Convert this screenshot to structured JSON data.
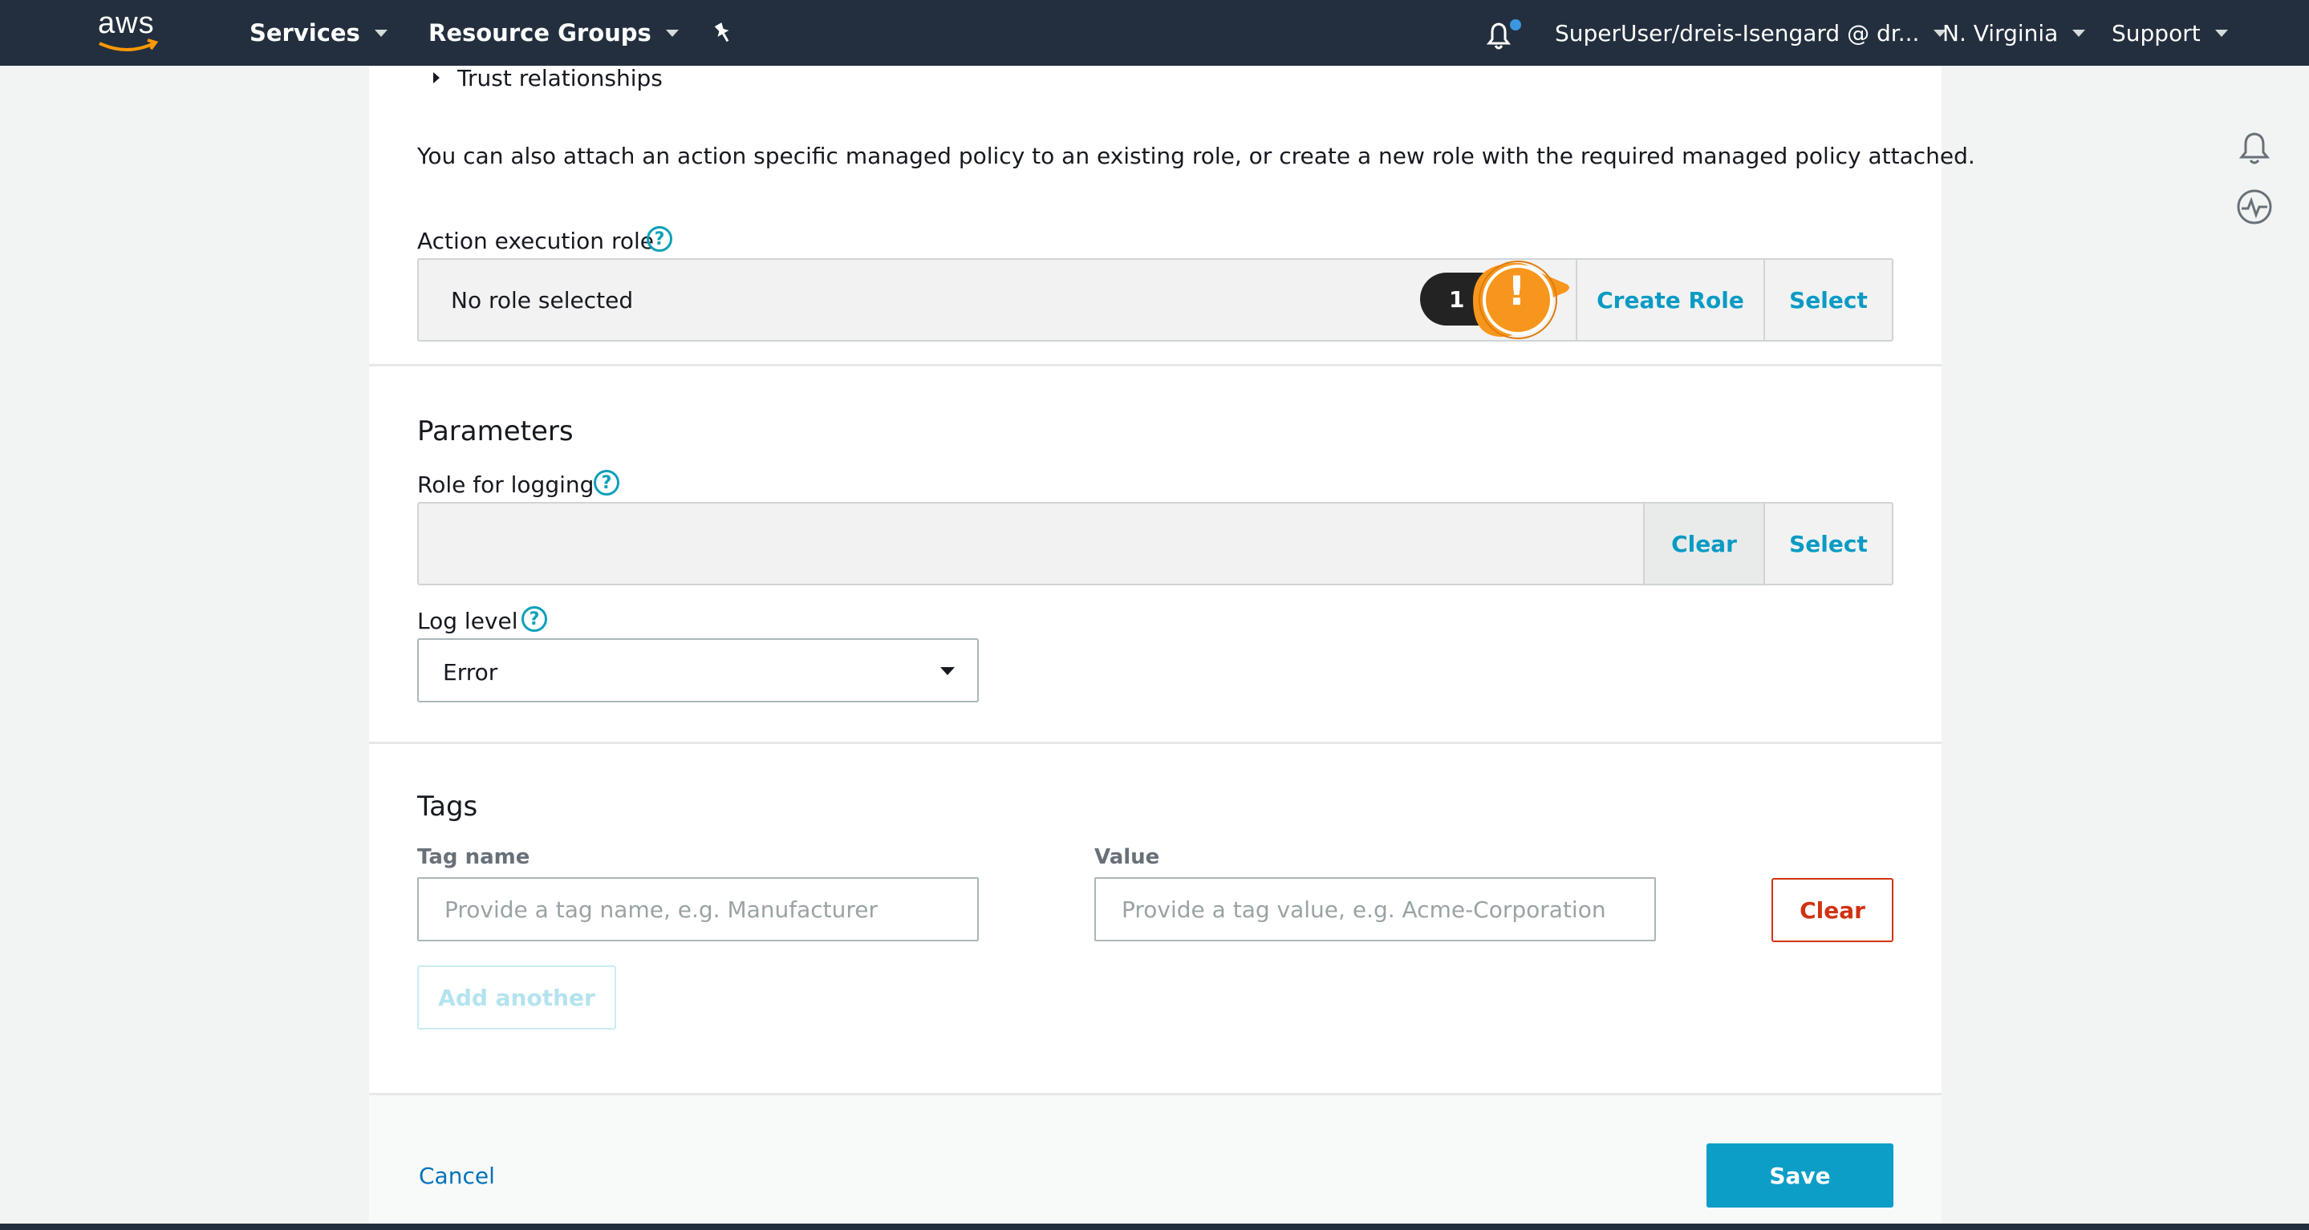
{
  "nav": {
    "logo": "aws",
    "services": "Services",
    "resource_groups": "Resource Groups",
    "account": "SuperUser/dreis-Isengard @ dr...",
    "region": "N. Virginia",
    "support": "Support"
  },
  "trust": {
    "label": "Trust relationships"
  },
  "info_text": "You can also attach an action specific managed policy to an existing role, or create a new role with the required managed policy attached.",
  "action_role": {
    "label": "Action execution role",
    "value": "No role selected",
    "create_label": "Create Role",
    "select_label": "Select",
    "hint_number": "1",
    "hint_mark": "!"
  },
  "parameters": {
    "title": "Parameters",
    "logging_label": "Role for logging",
    "clear_label": "Clear",
    "select_label": "Select",
    "log_level_label": "Log level",
    "log_level_value": "Error"
  },
  "tags": {
    "title": "Tags",
    "name_label": "Tag name",
    "name_placeholder": "Provide a tag name, e.g. Manufacturer",
    "value_label": "Value",
    "value_placeholder": "Provide a tag value, e.g. Acme-Corporation",
    "clear_label": "Clear",
    "add_label": "Add another"
  },
  "footer": {
    "cancel": "Cancel",
    "save": "Save"
  },
  "colors": {
    "nav_bg": "#232f3e",
    "accent": "#0a9bc4",
    "save_bg": "#0d9ec8",
    "danger": "#d13212",
    "hint": "#f7961c"
  }
}
